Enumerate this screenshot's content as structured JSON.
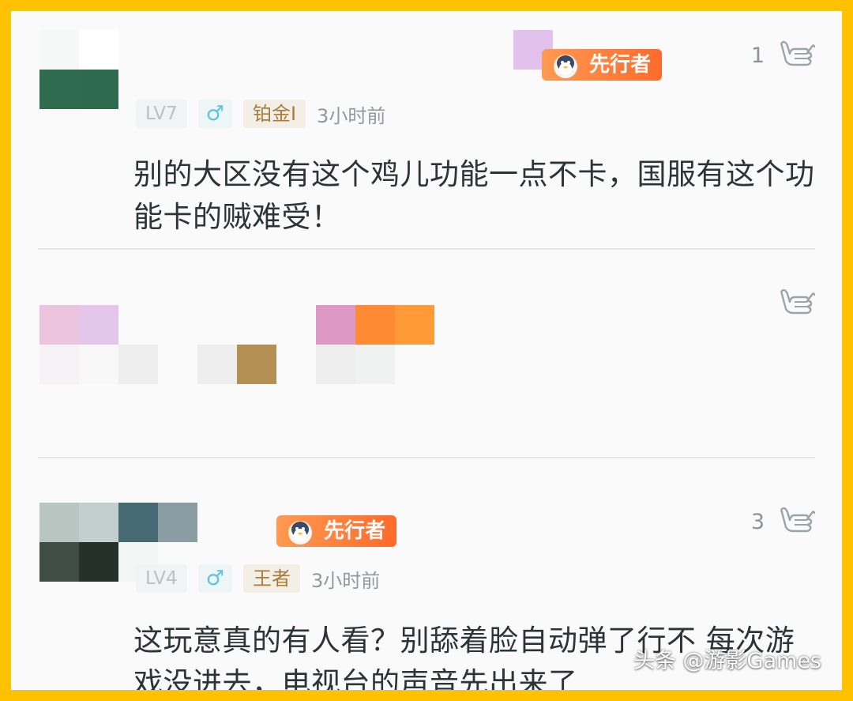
{
  "comments": [
    {
      "badge": "先行者",
      "level": "LV7",
      "gender": "♂",
      "rank": "铂金I",
      "time": "3小时前",
      "likes": "1",
      "text": "别的大区没有这个鸡儿功能一点不卡，国服有这个功能卡的贼难受！"
    },
    {
      "likes": ""
    },
    {
      "badge": "先行者",
      "level": "LV4",
      "gender": "♂",
      "rank": "王者",
      "time": "3小时前",
      "likes": "3",
      "text": "这玩意真的有人看？别舔着脸自动弹了行不 每次游戏没进去，电视台的声音先出来了"
    }
  ],
  "watermark": "头条 @游影Games",
  "icons": {
    "like": "shaka-hand-icon",
    "badge_mascot": "penguin-icon"
  },
  "colors": {
    "frame": "#ffc100",
    "badge": "#ff7a35",
    "text": "#2d3436"
  }
}
